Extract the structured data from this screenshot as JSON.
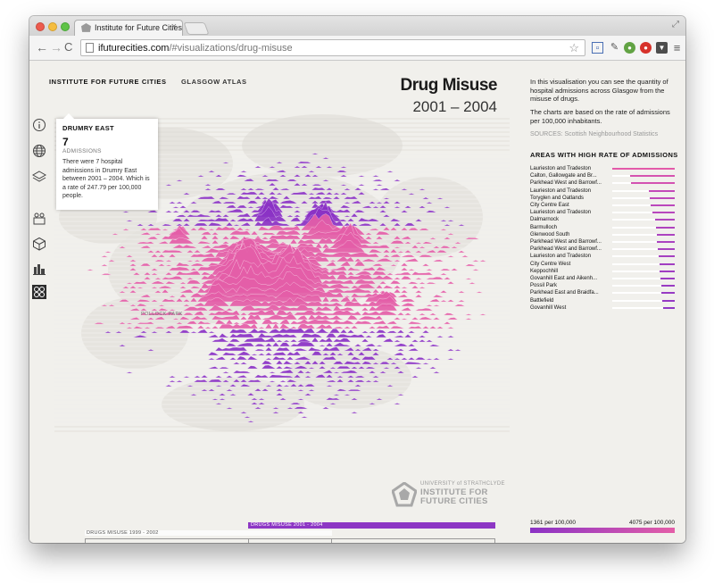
{
  "browser": {
    "tab_title": "Institute for Future Cities",
    "tab_close": "×",
    "url_host": "ifuturecities.com",
    "url_path": "/#visualizations/drug-misuse",
    "back_glyph": "←",
    "forward_glyph": "→",
    "reload_glyph": "C",
    "star_glyph": "☆",
    "menu_glyph": "≡"
  },
  "header": {
    "brand": "INSTITUTE FOR FUTURE CITIES",
    "section": "GLASGOW ATLAS",
    "title": "Drug Misuse",
    "subtitle": "2001 – 2004"
  },
  "sidebar_icons": [
    "info-icon",
    "globe-icon",
    "layers-icon",
    "population-icon",
    "box-icon",
    "city-icon",
    "map-grid-icon"
  ],
  "tooltip": {
    "area": "DRUMRY EAST",
    "value": "7",
    "unit": "ADMISSIONS",
    "description": "There were 7 hospital admissions in Drumry East between 2001 – 2004. Which is a rate of 247.79 per 100,000 people."
  },
  "map": {
    "place_label": "POLLOCK PARK",
    "colors": {
      "low": "#8b32c5",
      "high": "#e45ea8",
      "line": "#dcdad4"
    }
  },
  "logo": {
    "line1": "UNIVERSITY of STRATHCLYDE",
    "line2": "INSTITUTE FOR",
    "line3": "FUTURE CITIES"
  },
  "timeline": {
    "active_label": "DRUGS MISUSE 2001 - 2004",
    "previous_label": "DRUGS MISUSE 1999 - 2002"
  },
  "panel": {
    "description": "In this visualisation you can see the quantity of hospital admissions across Glasgow from the misuse of drugs.",
    "description2": "The charts are based on the rate of admissions per 100,000 inhabitants.",
    "sources": "SOURCES: Scottish Neighbourhood Statistics",
    "list_title": "AREAS WITH HIGH RATE OF ADMISSIONS",
    "areas": [
      {
        "name": "Laurieston and Tradeston",
        "value": 1.0,
        "color": "#e35aa9"
      },
      {
        "name": "Calton, Gallowgate and Br...",
        "value": 0.72,
        "color": "#d553b0"
      },
      {
        "name": "Parkhead West and Barrowf...",
        "value": 0.7,
        "color": "#d352b2"
      },
      {
        "name": "Laurieston and Tradeston",
        "value": 0.42,
        "color": "#c34ab9"
      },
      {
        "name": "Toryglen and Oatlands",
        "value": 0.4,
        "color": "#be48bb"
      },
      {
        "name": "City Centre East",
        "value": 0.38,
        "color": "#bb47bc"
      },
      {
        "name": "Laurieston and Tradeston",
        "value": 0.36,
        "color": "#b846bd"
      },
      {
        "name": "Dalmarnock",
        "value": 0.32,
        "color": "#b245be"
      },
      {
        "name": "Barmulloch",
        "value": 0.3,
        "color": "#af44bf"
      },
      {
        "name": "Glenwood South",
        "value": 0.29,
        "color": "#ad43c0"
      },
      {
        "name": "Parkhead West and Barrowf...",
        "value": 0.28,
        "color": "#aa42c0"
      },
      {
        "name": "Parkhead West and Barrowf...",
        "value": 0.27,
        "color": "#a841c1"
      },
      {
        "name": "Laurieston and Tradeston",
        "value": 0.26,
        "color": "#a540c1"
      },
      {
        "name": "City Centre West",
        "value": 0.25,
        "color": "#a23fc2"
      },
      {
        "name": "Keppochhill",
        "value": 0.24,
        "color": "#a03ec2"
      },
      {
        "name": "Govanhill East and Aikenh...",
        "value": 0.23,
        "color": "#9d3dc3"
      },
      {
        "name": "Possil Park",
        "value": 0.22,
        "color": "#9a3cc3"
      },
      {
        "name": "Parkhead East and Braidfa...",
        "value": 0.21,
        "color": "#973bc4"
      },
      {
        "name": "Battlefield",
        "value": 0.2,
        "color": "#943ac4"
      },
      {
        "name": "Govanhill West",
        "value": 0.18,
        "color": "#9139c5"
      }
    ],
    "legend_min": "1361 per 100,000",
    "legend_max": "4075 per 100,000"
  }
}
